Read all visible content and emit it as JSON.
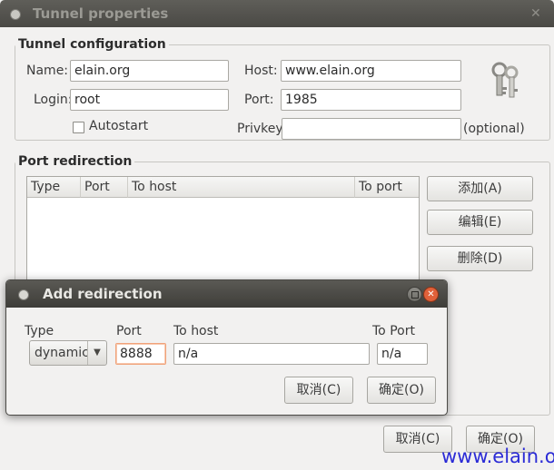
{
  "window": {
    "title": "Tunnel properties"
  },
  "tunnel_config": {
    "group_title": "Tunnel configuration",
    "name_label": "Name:",
    "name_value": "elain.org",
    "host_label": "Host:",
    "host_value": "www.elain.org",
    "login_label": "Login:",
    "login_value": "root",
    "port_label": "Port:",
    "port_value": "1985",
    "autostart_label": "Autostart",
    "autostart_checked": false,
    "privkey_label": "Privkey",
    "privkey_value": "",
    "privkey_hint": "(optional)"
  },
  "port_redirection": {
    "group_title": "Port redirection",
    "columns": [
      "Type",
      "Port",
      "To host",
      "To port"
    ],
    "rows": [],
    "add_button": "添加(A)",
    "edit_button": "编辑(E)",
    "delete_button": "删除(D)"
  },
  "footer": {
    "cancel_button": "取消(C)",
    "ok_button": "确定(O)"
  },
  "dialog": {
    "title": "Add redirection",
    "type_label": "Type",
    "type_value": "dynamic",
    "port_label": "Port",
    "port_value": "8888",
    "to_host_label": "To host",
    "to_host_value": "n/a",
    "to_port_label": "To Port",
    "to_port_value": "n/a",
    "cancel_button": "取消(C)",
    "ok_button": "确定(O)"
  },
  "watermark": "www.elain.org",
  "colors": {
    "dialog_close": "#e0613a",
    "watermark": "#2b2bd6",
    "titlebar": "#4a4945"
  }
}
